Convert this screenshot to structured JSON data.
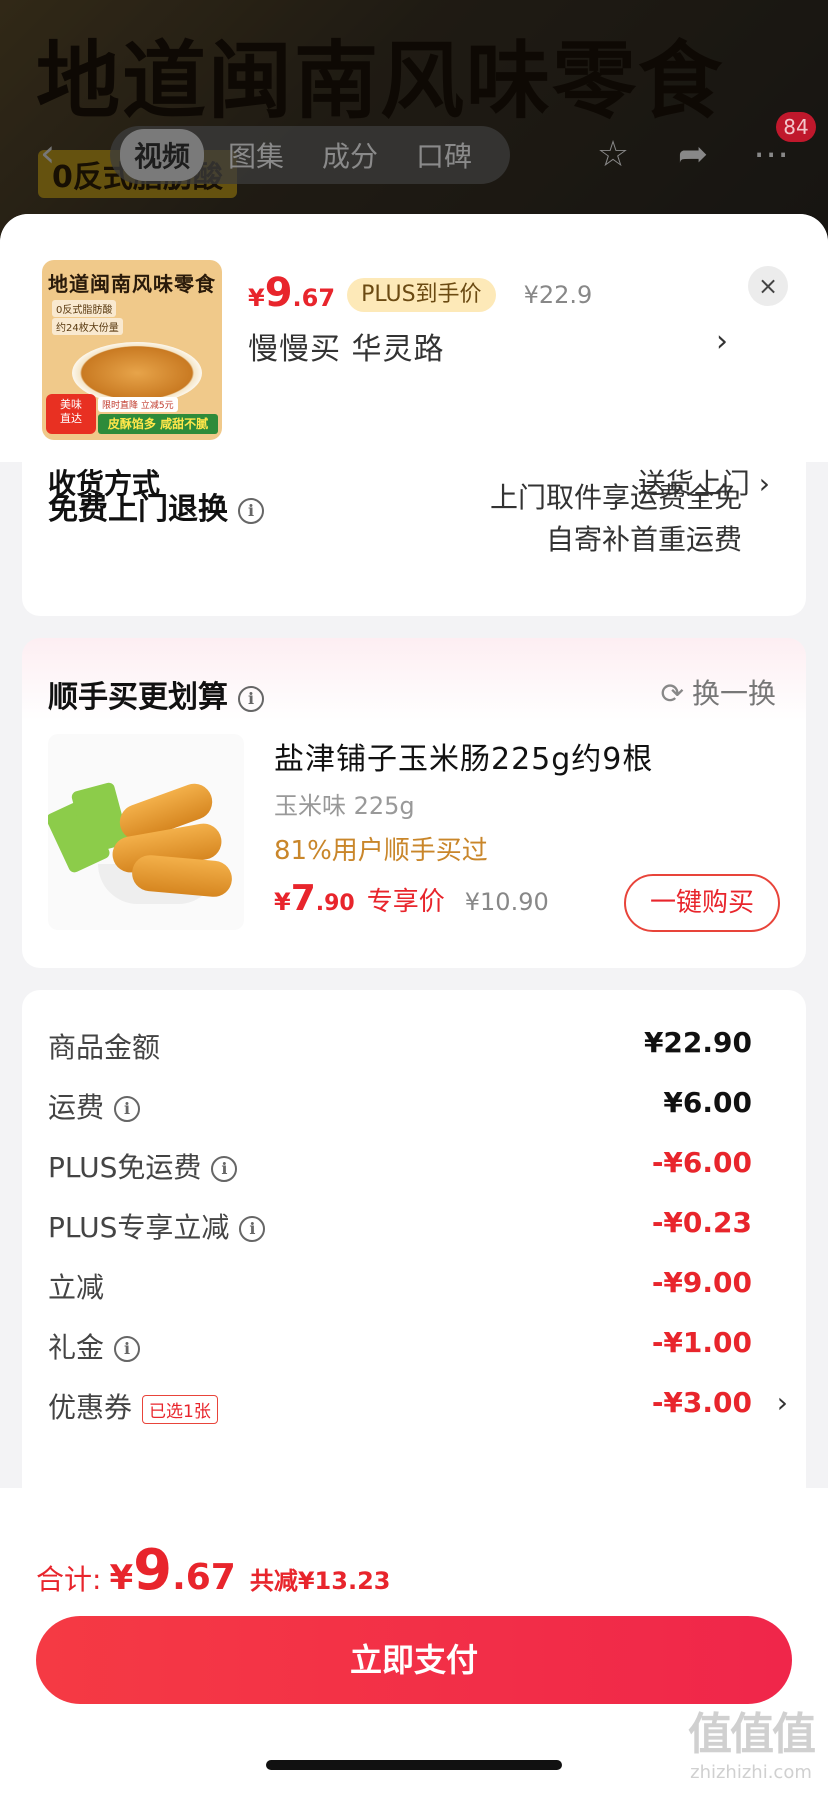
{
  "background": {
    "banner_text": "地道闽南风味零食",
    "sub_text": "0反式脂肪酸",
    "tabs": [
      "视频",
      "图集",
      "成分",
      "口碑"
    ],
    "active_tab": "视频",
    "message_count": "84"
  },
  "product": {
    "thumb_title": "地道闽南风味零食",
    "thumb_tag1": "0反式脂肪酸",
    "thumb_tag2": "约24枚大份量",
    "thumb_badge": "美味\n直达",
    "thumb_promo": "限时直降 立减5元",
    "thumb_strip": "皮酥馅多 咸甜不腻",
    "price_symbol": "¥",
    "price_int": "9",
    "price_dec": ".67",
    "plus_label": "PLUS到手价",
    "orig_price": "¥22.9",
    "address": "慢慢买  华灵路",
    "close": "×"
  },
  "delivery": {
    "clipped_left": "收货方式",
    "clipped_right": "送货上门 ›",
    "return_label": "免费上门退换",
    "return_value1": "上门取件享运费全免",
    "return_value2": "自寄补首重运费"
  },
  "addon": {
    "title": "顺手买更划算",
    "swap": "换一换",
    "name": "盐津铺子玉米肠225g约9根",
    "spec": "玉米味 225g",
    "stat": "81%用户顺手买过",
    "price_symbol": "¥",
    "price_int": "7",
    "price_dec": ".90",
    "price_label": "专享价",
    "orig_price": "¥10.90",
    "buy_button": "一键购买"
  },
  "summary": {
    "rows": [
      {
        "label": "商品金额",
        "value": "¥22.90",
        "red": false,
        "info": false
      },
      {
        "label": "运费",
        "value": "¥6.00",
        "red": false,
        "info": true
      },
      {
        "label": "PLUS免运费",
        "value": "-¥6.00",
        "red": true,
        "info": true
      },
      {
        "label": "PLUS专享立减",
        "value": "-¥0.23",
        "red": true,
        "info": true
      },
      {
        "label": "立减",
        "value": "-¥9.00",
        "red": true,
        "info": false
      },
      {
        "label": "礼金",
        "value": "-¥1.00",
        "red": true,
        "info": true
      },
      {
        "label": "优惠券",
        "value": "-¥3.00",
        "red": true,
        "info": false
      }
    ],
    "coupon_tag": "已选1张"
  },
  "footer": {
    "total_label": "合计:",
    "total_symbol": "¥",
    "total_int": "9",
    "total_dec": ".67",
    "total_saved": "共减¥13.23",
    "pay_button": "立即支付"
  },
  "watermark": {
    "logo": "值值值",
    "url": "zhizhizhi.com"
  },
  "colors": {
    "accent_red": "#e8252c",
    "plus_bg": "#fde9b8",
    "stat_orange": "#c9862a"
  }
}
